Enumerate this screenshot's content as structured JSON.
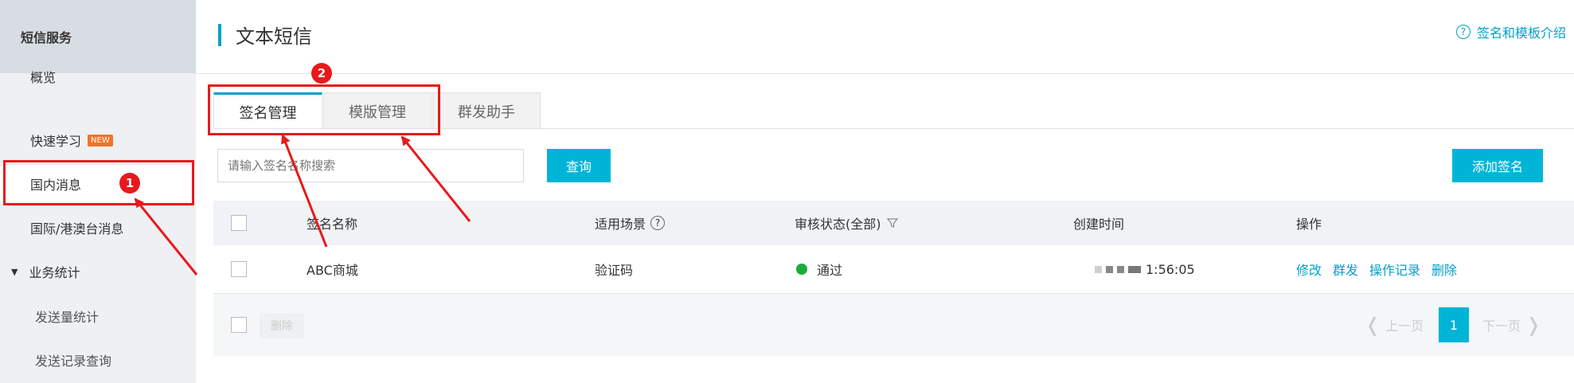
{
  "sidebar": {
    "header": "短信服务",
    "items": [
      {
        "label": "概览"
      },
      {
        "label": "快速学习",
        "badge": "NEW"
      },
      {
        "label": "国内消息"
      },
      {
        "label": "国际/港澳台消息"
      },
      {
        "label": "业务统计"
      },
      {
        "label": "发送量统计"
      },
      {
        "label": "发送记录查询"
      }
    ]
  },
  "header": {
    "title": "文本短信",
    "help_icon": "?",
    "help_link": "签名和模板介绍"
  },
  "tabs": [
    {
      "label": "签名管理",
      "active": true
    },
    {
      "label": "模版管理",
      "active": false
    },
    {
      "label": "群发助手",
      "active": false
    }
  ],
  "search": {
    "placeholder": "请输入签名名称搜索",
    "button": "查询"
  },
  "add_button": "添加签名",
  "table": {
    "columns": [
      "签名名称",
      "适用场景",
      "审核状态(全部)",
      "创建时间",
      "操作"
    ],
    "scene_help_icon": "?",
    "rows": [
      {
        "name": "ABC商城",
        "scene": "验证码",
        "status": "通过",
        "created": "1:56:05",
        "actions": [
          "修改",
          "群发",
          "操作记录",
          "删除"
        ]
      }
    ],
    "footer_delete": "删除"
  },
  "pagination": {
    "prev": "上一页",
    "current": "1",
    "next": "下一页"
  },
  "annotations": {
    "marker1": "1",
    "marker2": "2",
    "color": "#e8191c"
  },
  "colors": {
    "accent": "#00a2ca",
    "button": "#00b4d8",
    "status_ok": "#1aab3a",
    "badge": "#f37327"
  }
}
